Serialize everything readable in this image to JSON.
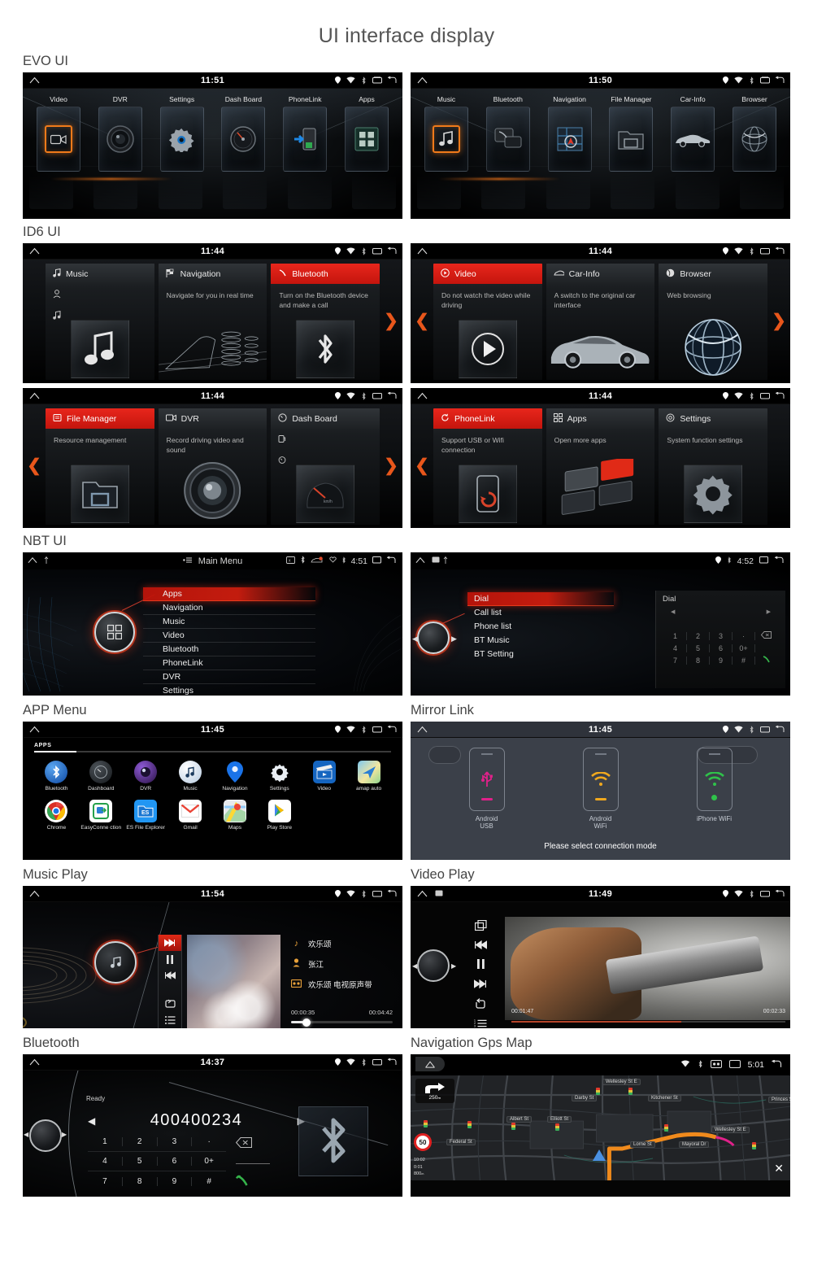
{
  "page": {
    "title": "UI interface display"
  },
  "sections": {
    "evo": "EVO UI",
    "id6": "ID6 UI",
    "nbt": "NBT UI",
    "app_menu": "APP Menu",
    "mirror_link": "Mirror Link",
    "music_play": "Music Play",
    "video_play": "Video Play",
    "bluetooth": "Bluetooth",
    "navigation": "Navigation Gps Map"
  },
  "status_icons": [
    "location-icon",
    "wifi-icon",
    "bluetooth-icon",
    "recents-icon",
    "back-icon"
  ],
  "evo": {
    "left": {
      "time": "11:51",
      "items": [
        {
          "label": "Video",
          "icon": "video-camera-icon",
          "selected": true
        },
        {
          "label": "DVR",
          "icon": "camera-lens-icon",
          "selected": false
        },
        {
          "label": "Settings",
          "icon": "gear-icon",
          "selected": false
        },
        {
          "label": "Dash Board",
          "icon": "gauge-icon",
          "selected": false
        },
        {
          "label": "PhoneLink",
          "icon": "phone-link-icon",
          "selected": false
        },
        {
          "label": "Apps",
          "icon": "apps-grid-icon",
          "selected": false
        }
      ]
    },
    "right": {
      "time": "11:50",
      "items": [
        {
          "label": "Music",
          "icon": "music-note-icon",
          "selected": true
        },
        {
          "label": "Bluetooth",
          "icon": "phone-chat-icon",
          "selected": false
        },
        {
          "label": "Navigation",
          "icon": "map-arrow-icon",
          "selected": false
        },
        {
          "label": "File Manager",
          "icon": "folder-icon",
          "selected": false
        },
        {
          "label": "Car-Info",
          "icon": "car-icon",
          "selected": false
        },
        {
          "label": "Browser",
          "icon": "globe-icon",
          "selected": false
        }
      ]
    }
  },
  "id6": {
    "row1_left": {
      "time": "11:44",
      "prev_arrow": false,
      "next_arrow": true,
      "cards": [
        {
          "title": "Music",
          "icon": "music-note-icon",
          "desc": "",
          "art": "music-note-icon",
          "active": false
        },
        {
          "title": "Navigation",
          "icon": "checkered-flag-icon",
          "desc": "Navigate for you in real time",
          "art": "road-city-icon",
          "active": false
        },
        {
          "title": "Bluetooth",
          "icon": "phone-handset-icon",
          "desc": "Turn on the Bluetooth device and make a call",
          "art": "bluetooth-icon",
          "active": true
        }
      ]
    },
    "row1_right": {
      "time": "11:44",
      "prev_arrow": true,
      "next_arrow": true,
      "cards": [
        {
          "title": "Video",
          "icon": "play-circle-icon",
          "desc": "Do not watch the video while driving",
          "art": "play-circle-icon",
          "active": true
        },
        {
          "title": "Car-Info",
          "icon": "car-outline-icon",
          "desc": "A switch to the original car interface",
          "art": "car-icon",
          "active": false
        },
        {
          "title": "Browser",
          "icon": "globe-icon",
          "desc": "Web browsing",
          "art": "globe-icon",
          "active": false
        }
      ]
    },
    "row2_left": {
      "time": "11:44",
      "prev_arrow": true,
      "next_arrow": true,
      "cards": [
        {
          "title": "File Manager",
          "icon": "folder-doc-icon",
          "desc": "Resource management",
          "art": "folder-icon",
          "active": true
        },
        {
          "title": "DVR",
          "icon": "video-camera-icon",
          "desc": "Record driving video and sound",
          "art": "camera-lens-icon",
          "active": false
        },
        {
          "title": "Dash Board",
          "icon": "gauge-icon",
          "desc": "",
          "art": "gauge-icon",
          "active": false
        }
      ]
    },
    "row2_right": {
      "time": "11:44",
      "prev_arrow": true,
      "next_arrow": false,
      "cards": [
        {
          "title": "PhoneLink",
          "icon": "refresh-circle-icon",
          "desc": "Support USB or Wifi connection",
          "art": "phone-refresh-icon",
          "active": true
        },
        {
          "title": "Apps",
          "icon": "apps-grid-icon",
          "desc": "Open more apps",
          "art": "four-tiles-icon",
          "active": false
        },
        {
          "title": "Settings",
          "icon": "gear-outline-icon",
          "desc": "System function settings",
          "art": "gear-icon",
          "active": false
        }
      ]
    }
  },
  "nbt": {
    "left": {
      "time": "4:51",
      "header": "Main Menu",
      "menu": [
        "Apps",
        "Navigation",
        "Music",
        "Video",
        "Bluetooth",
        "PhoneLink",
        "DVR",
        "Settings"
      ],
      "active_index": 0,
      "knob_icon": "apps-grid-icon"
    },
    "right": {
      "time": "4:52",
      "menu": [
        "Dial",
        "Call list",
        "Phone list",
        "BT Music",
        "BT Setting"
      ],
      "active_index": 0,
      "panel_title": "Dial",
      "keypad": [
        [
          "1",
          "2",
          "3",
          "·"
        ],
        [
          "4",
          "5",
          "6",
          "0+"
        ],
        [
          "7",
          "8",
          "9",
          "#"
        ]
      ]
    }
  },
  "app_menu": {
    "time": "11:45",
    "tab": "APPS",
    "apps": [
      {
        "name": "Bluetooth",
        "icon": "bluetooth-icon",
        "color": "#1a73e8"
      },
      {
        "name": "Dashboard",
        "icon": "gauge-icon",
        "color": "#2b2f33"
      },
      {
        "name": "DVR",
        "icon": "camera-lens-icon",
        "color": "#4a2b6b"
      },
      {
        "name": "Music",
        "icon": "music-note-icon",
        "color": "#e9eef5"
      },
      {
        "name": "Navigation",
        "icon": "map-pin-icon",
        "color": "#1a73e8"
      },
      {
        "name": "Settings",
        "icon": "gear-icon",
        "color": "#000000"
      },
      {
        "name": "Video",
        "icon": "clapperboard-icon",
        "color": "#1565c0"
      },
      {
        "name": "amap auto",
        "icon": "amap-icon",
        "color": "#3f9ae0"
      },
      {
        "name": "Chrome",
        "icon": "chrome-icon",
        "color": "#ffffff"
      },
      {
        "name": "EasyConne ction",
        "icon": "easyconnection-icon",
        "color": "#ffffff"
      },
      {
        "name": "ES File Explorer",
        "icon": "es-file-icon",
        "color": "#2196f3"
      },
      {
        "name": "Gmail",
        "icon": "gmail-icon",
        "color": "#ffffff"
      },
      {
        "name": "Maps",
        "icon": "maps-icon",
        "color": "#ffffff"
      },
      {
        "name": "Play Store",
        "icon": "play-store-icon",
        "color": "#ffffff"
      }
    ]
  },
  "mirror_link": {
    "time": "11:45",
    "modes": [
      {
        "label": "Android USB",
        "icon": "usb-icon",
        "color": "#e0218a"
      },
      {
        "label": "Android WiFi",
        "icon": "wifi-icon",
        "color": "#f0a81e"
      },
      {
        "label": "iPhone WiFi",
        "icon": "wifi-icon",
        "color": "#2fc24a"
      }
    ],
    "hint": "Please select connection mode"
  },
  "music_play": {
    "time": "11:54",
    "track_title": "欢乐颂",
    "artist": "张江",
    "album": "欢乐颂 电视原声带",
    "current_time": "00:00:35",
    "total_time": "00:04:42",
    "controls": [
      "next-track-icon",
      "pause-icon",
      "prev-track-icon",
      "repeat-icon",
      "playlist-icon"
    ]
  },
  "video_play": {
    "time": "11:49",
    "current_time": "00:01:47",
    "total_time": "00:02:33",
    "controls": [
      "screen-switch-icon",
      "prev-track-icon",
      "pause-icon",
      "next-track-icon",
      "repeat-icon",
      "playlist-icon"
    ]
  },
  "bluetooth": {
    "time": "14:37",
    "status": "Ready",
    "number": "400400234",
    "keypad": [
      [
        "1",
        "2",
        "3",
        "·"
      ],
      [
        "4",
        "5",
        "6",
        "0+"
      ],
      [
        "7",
        "8",
        "9",
        "#"
      ]
    ],
    "backspace_icon": "backspace-icon",
    "call_icon": "call-icon",
    "logo_icon": "bluetooth-icon"
  },
  "navigation": {
    "time": "5:01",
    "turn_distance": "250ₘ",
    "speed_limit": "50",
    "eta_rows": [
      "10:02",
      "0:01",
      "800ₘ"
    ],
    "street_labels": [
      "Wellesley St E",
      "Darby St",
      "Kitchener St",
      "Princes S",
      "Albert St",
      "Elliott St",
      "Wellesley St E",
      "Federal St",
      "Lorne St",
      "Mayoral Dr"
    ]
  }
}
